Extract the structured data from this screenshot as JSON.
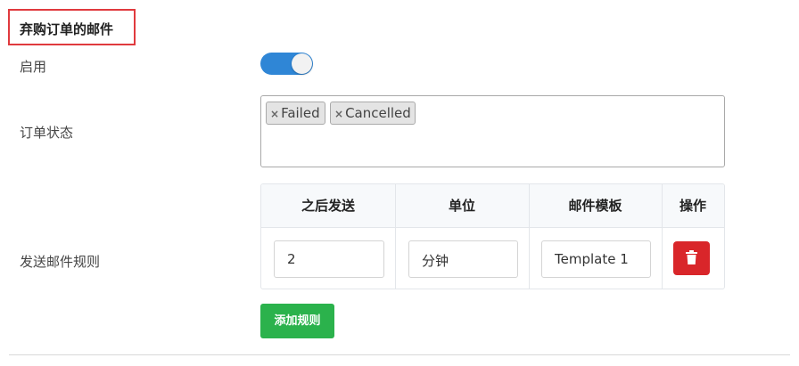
{
  "section": {
    "title": "弃购订单的邮件"
  },
  "enable": {
    "label": "启用",
    "state": "on",
    "accent": "#2f86d6"
  },
  "order_status": {
    "label": "订单状态",
    "tags": [
      {
        "remove_glyph": "×",
        "text": "Failed"
      },
      {
        "remove_glyph": "×",
        "text": "Cancelled"
      }
    ]
  },
  "rules": {
    "label": "发送邮件规则",
    "columns": [
      "之后发送",
      "单位",
      "邮件模板",
      "操作"
    ],
    "rows": [
      {
        "after": "2",
        "unit": "分钟",
        "template": "Template 1",
        "action_icon": "trash-icon"
      }
    ],
    "delete_color": "#d9262a"
  },
  "add_rule": {
    "label": "添加规则",
    "color": "#2bb24c"
  }
}
